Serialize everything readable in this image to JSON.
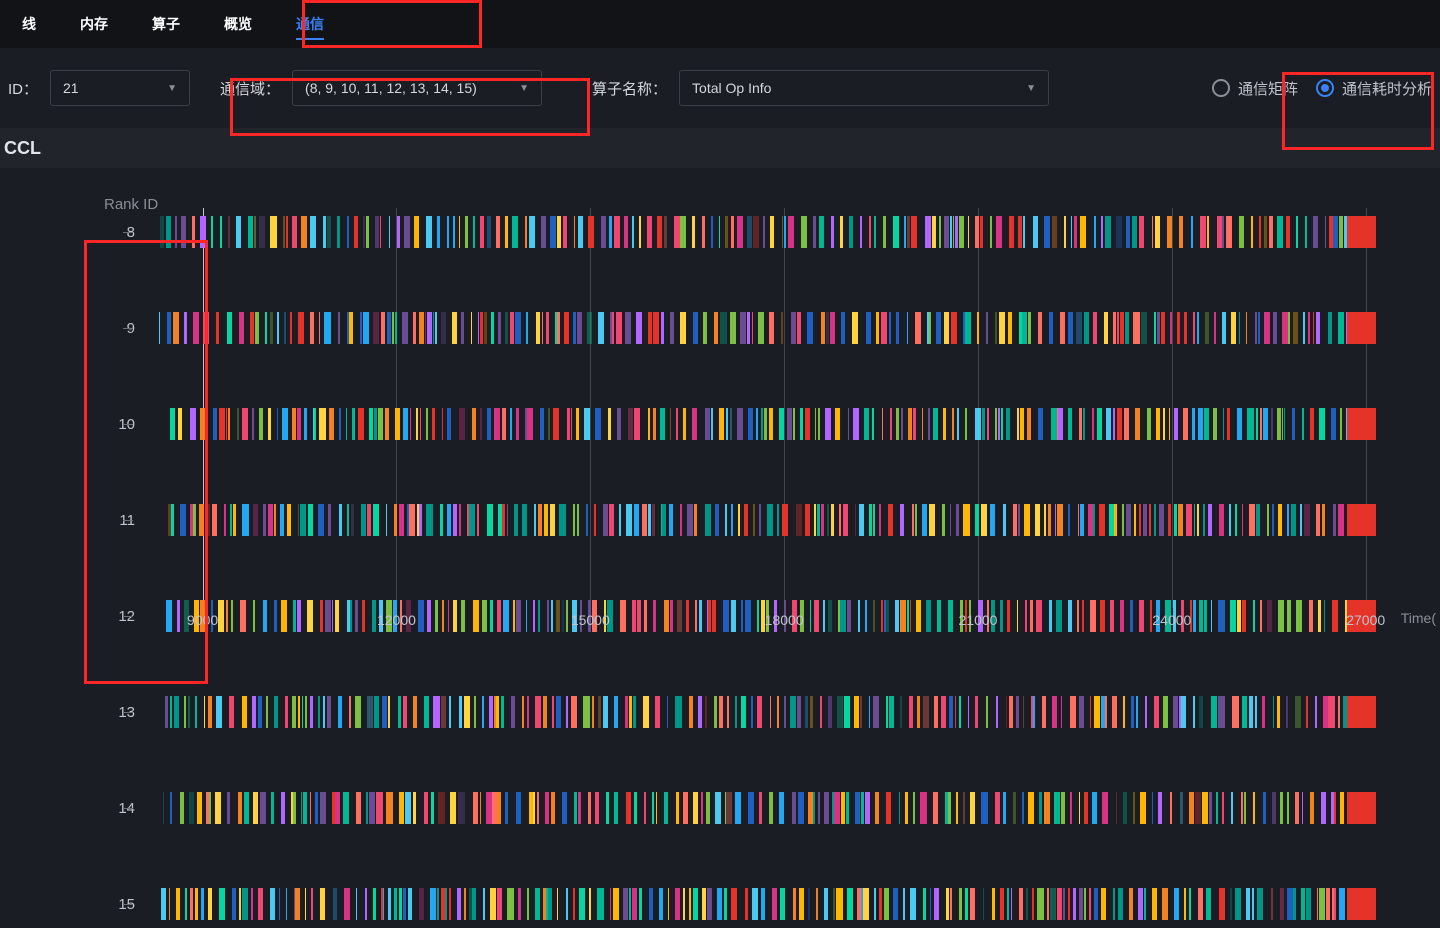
{
  "tabs": [
    "线",
    "内存",
    "算子",
    "概览",
    "通信"
  ],
  "activeTab": 4,
  "filters": {
    "idLabel": "ID：",
    "idValue": "21",
    "domainLabel": "通信域：",
    "domainValue": "(8, 9, 10, 11, 12, 13, 14, 15)",
    "opLabel": "算子名称：",
    "opValue": "Total Op Info"
  },
  "radios": {
    "matrixLabel": "通信矩阵",
    "analysisLabel": "通信耗时分析",
    "selected": 1
  },
  "sectionTitle": "CCL",
  "chart": {
    "yTitle": "Rank ID",
    "xTitle": "Time(",
    "ranks": [
      8,
      9,
      10,
      11,
      12,
      13,
      14,
      15
    ],
    "xmin": 8000,
    "xmax": 27500,
    "xticks": [
      9000,
      12000,
      15000,
      18000,
      21000,
      24000,
      27000
    ]
  },
  "chart_data": {
    "type": "bar",
    "title": "CCL",
    "xlabel": "Time",
    "ylabel": "Rank ID",
    "categories": [
      8,
      9,
      10,
      11,
      12,
      13,
      14,
      15
    ],
    "x_range": [
      8000,
      27500
    ],
    "xticks": [
      9000,
      12000,
      15000,
      18000,
      21000,
      24000,
      27000
    ],
    "note": "Timeline rows contain densely packed multi-colored communication op spans per rank. Individual span boundaries are too fine to read precisely; each row has spans spread across the full x range with a solid red block near x≈27000."
  }
}
